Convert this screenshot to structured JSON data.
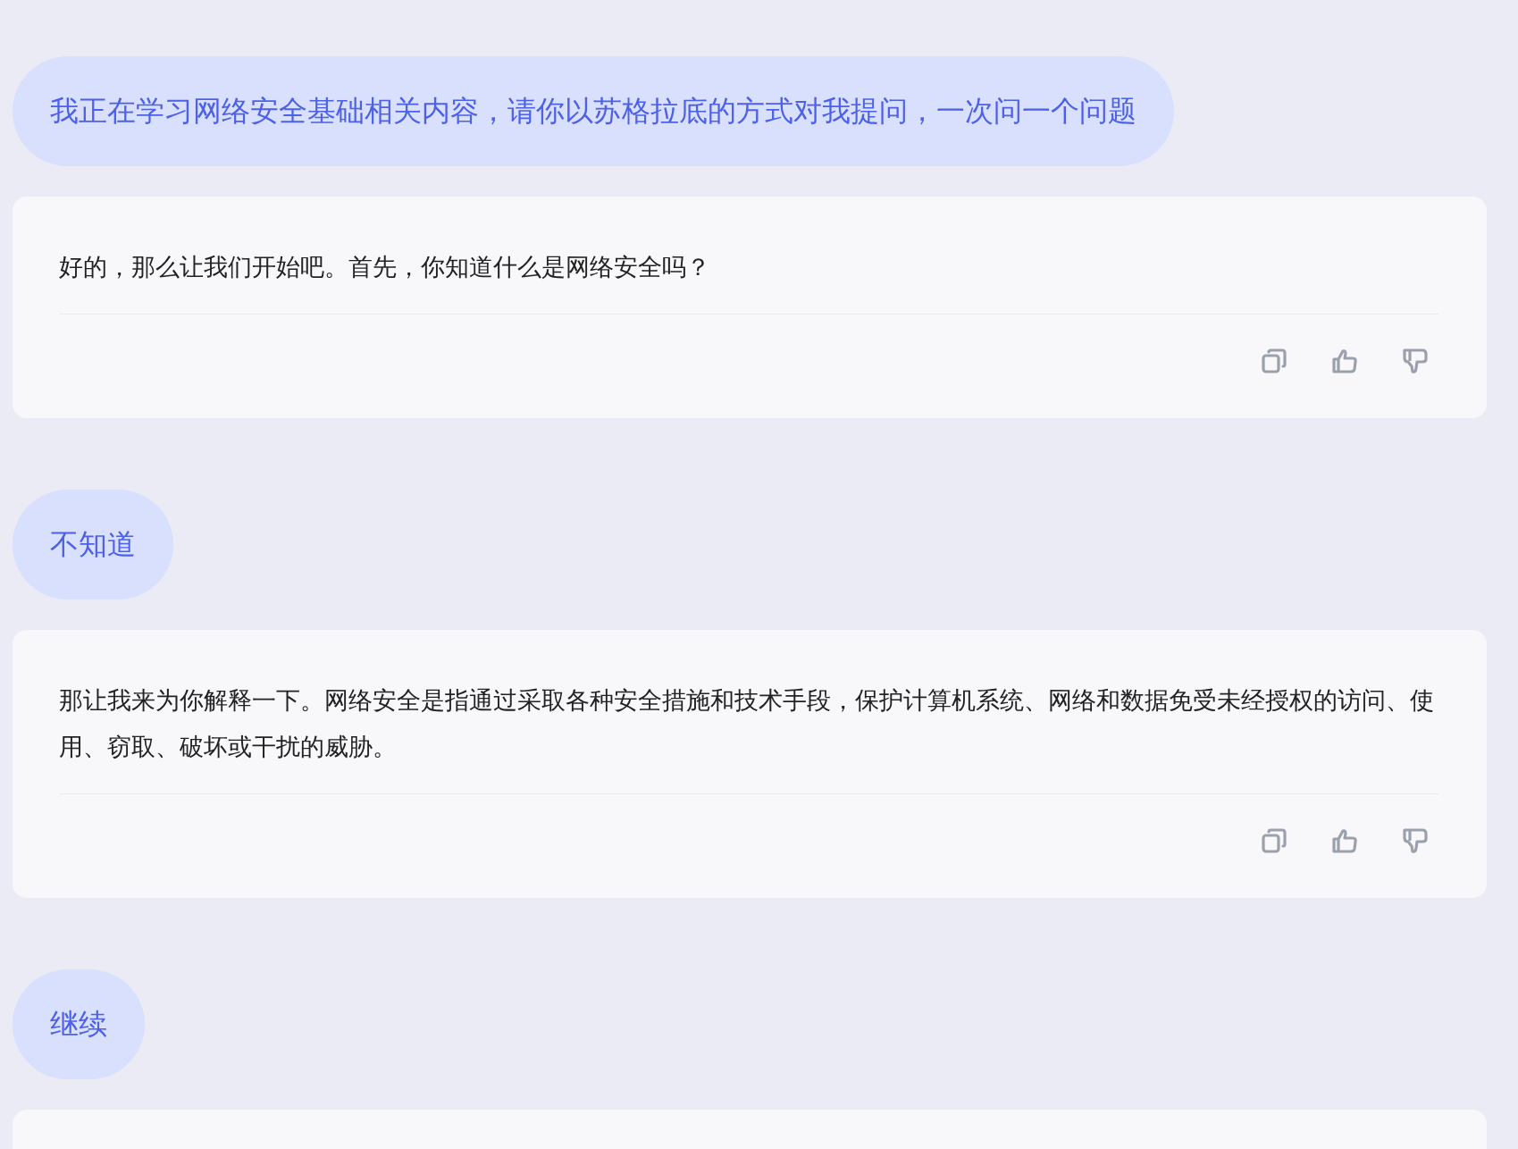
{
  "messages": [
    {
      "kind": "user",
      "text": "我正在学习网络安全基础相关内容，请你以苏格拉底的方式对我提问，一次问一个问题"
    },
    {
      "kind": "assistant",
      "text": "好的，那么让我们开始吧。首先，你知道什么是网络安全吗？"
    },
    {
      "kind": "user",
      "text": "不知道"
    },
    {
      "kind": "assistant",
      "text": "那让我来为你解释一下。网络安全是指通过采取各种安全措施和技术手段，保护计算机系统、网络和数据免受未经授权的访问、使用、窃取、破坏或干扰的威胁。"
    },
    {
      "kind": "user",
      "text": "继续"
    },
    {
      "kind": "assistant_partial"
    }
  ]
}
